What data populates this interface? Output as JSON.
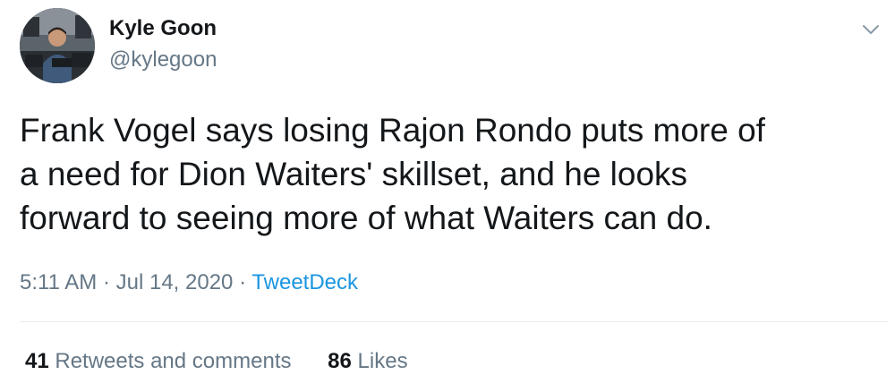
{
  "author": {
    "display_name": "Kyle Goon",
    "handle": "@kylegoon"
  },
  "tweet": {
    "text": "Frank Vogel says losing Rajon Rondo puts more of\na need for Dion Waiters' skillset, and he looks\nforward to seeing more of what Waiters can do.",
    "time": "5:11 AM",
    "date": "Jul 14, 2020",
    "separator": "·",
    "source": "TweetDeck"
  },
  "stats": {
    "retweets_count": "41",
    "retweets_label": "Retweets and comments",
    "likes_count": "86",
    "likes_label": "Likes"
  },
  "icons": {
    "more": "chevron-down-icon"
  },
  "colors": {
    "text": "#14171a",
    "secondary": "#657786",
    "link": "#1b95e0",
    "divider": "#e6ecf0"
  }
}
